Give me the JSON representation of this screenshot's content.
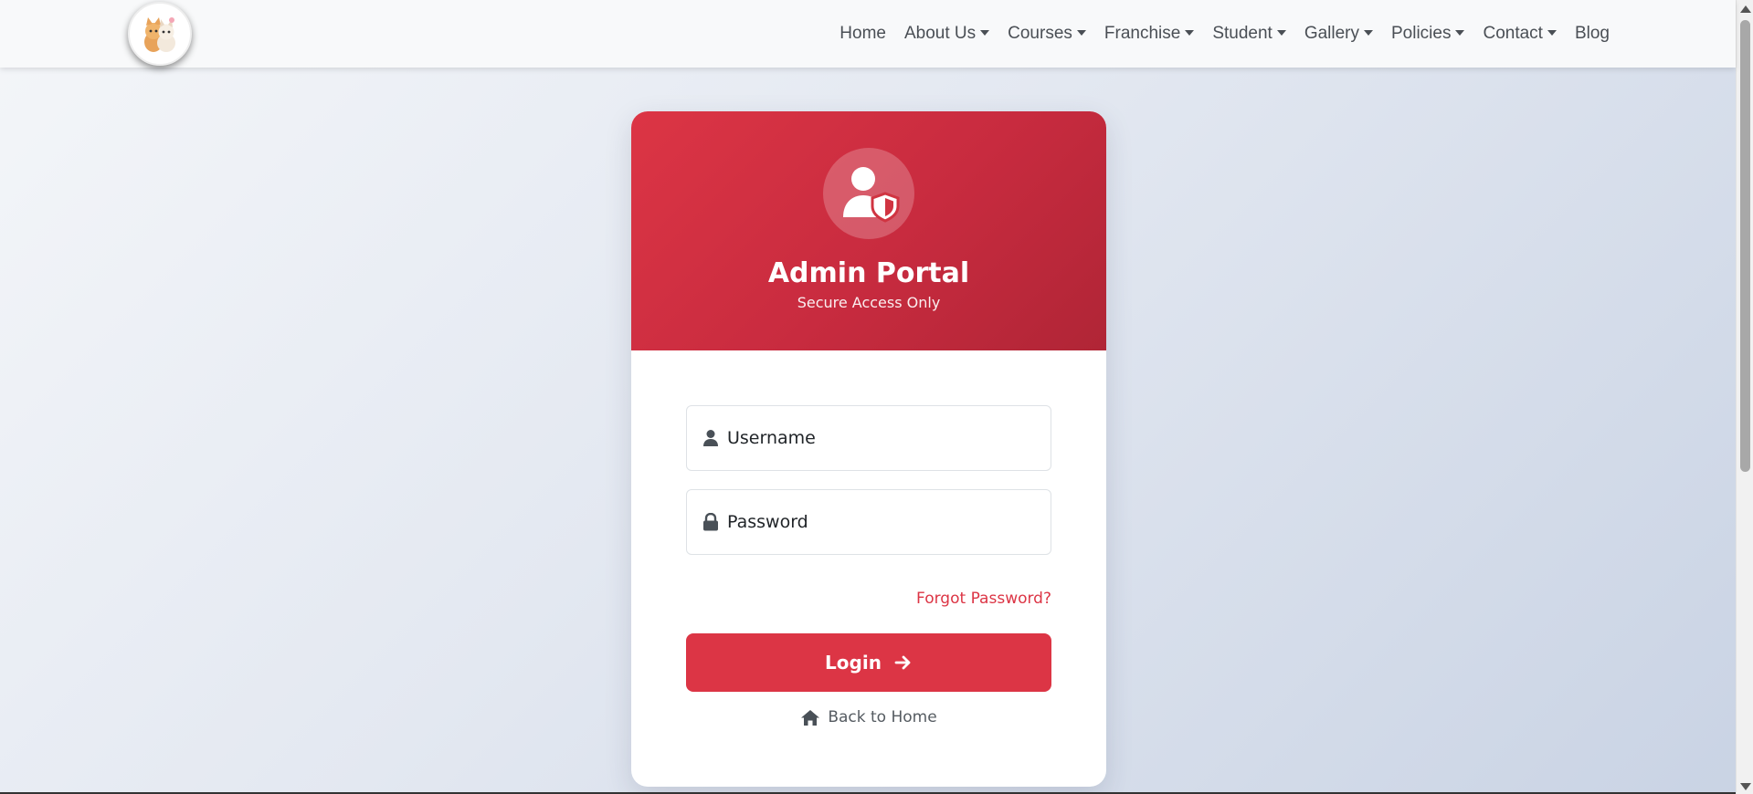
{
  "navbar": {
    "logo_name": "kittens-logo",
    "items": [
      {
        "label": "Home",
        "dropdown": false
      },
      {
        "label": "About Us",
        "dropdown": true
      },
      {
        "label": "Courses",
        "dropdown": true
      },
      {
        "label": "Franchise",
        "dropdown": true
      },
      {
        "label": "Student",
        "dropdown": true
      },
      {
        "label": "Gallery",
        "dropdown": true
      },
      {
        "label": "Policies",
        "dropdown": true
      },
      {
        "label": "Contact",
        "dropdown": true
      },
      {
        "label": "Blog",
        "dropdown": false
      }
    ]
  },
  "card": {
    "title": "Admin Portal",
    "subtitle": "Secure Access Only",
    "header_icon": "user-shield-icon",
    "username_placeholder": "Username",
    "password_placeholder": "Password",
    "forgot_label": "Forgot Password?",
    "login_label": "Login",
    "back_home_label": "Back to Home"
  },
  "colors": {
    "accent": "#dc3545",
    "accent_dark": "#b02536",
    "nav_text": "#4a4f55"
  }
}
